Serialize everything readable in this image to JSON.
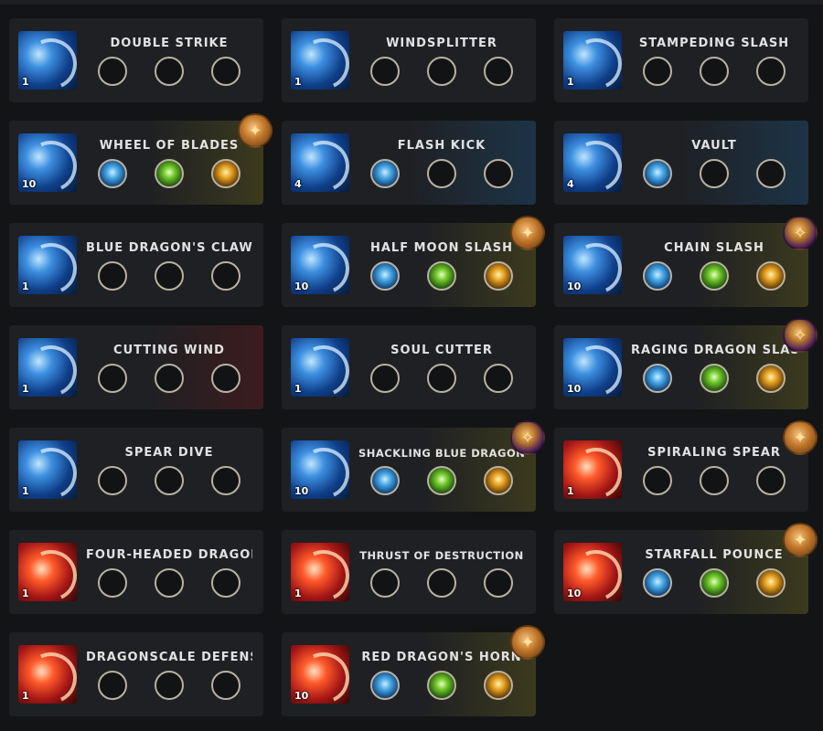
{
  "skills": [
    {
      "name": "DOUBLE STRIKE",
      "level": "1",
      "icon": "blue-swirl-skill-icon",
      "tripods": [
        null,
        null,
        null
      ],
      "rune": null
    },
    {
      "name": "WINDSPLITTER",
      "level": "1",
      "icon": "blue-swirl-skill-icon",
      "tripods": [
        null,
        null,
        null
      ],
      "rune": null
    },
    {
      "name": "STAMPEDING SLASH",
      "level": "1",
      "icon": "blue-swirl-skill-icon",
      "tripods": [
        null,
        null,
        null
      ],
      "rune": null
    },
    {
      "name": "WHEEL OF BLADES",
      "level": "10",
      "icon": "blue-swirl-skill-icon",
      "tripods": [
        "blue",
        "green",
        "orange"
      ],
      "rune": "bronze"
    },
    {
      "name": "FLASH KICK",
      "level": "4",
      "icon": "blue-swirl-skill-icon",
      "tripods": [
        "blue",
        null,
        null
      ],
      "rune": null
    },
    {
      "name": "VAULT",
      "level": "4",
      "icon": "blue-swirl-skill-icon",
      "tripods": [
        "blue",
        null,
        null
      ],
      "rune": null
    },
    {
      "name": "BLUE DRAGON'S CLAW",
      "level": "1",
      "icon": "blue-swirl-skill-icon",
      "tripods": [
        null,
        null,
        null
      ],
      "rune": null
    },
    {
      "name": "HALF MOON SLASH",
      "level": "10",
      "icon": "blue-swirl-skill-icon",
      "tripods": [
        "blue",
        "green",
        "orange"
      ],
      "rune": "bronze"
    },
    {
      "name": "CHAIN SLASH",
      "level": "10",
      "icon": "blue-swirl-skill-icon",
      "tripods": [
        "blue",
        "green",
        "orange"
      ],
      "rune": "purple"
    },
    {
      "name": "CUTTING WIND",
      "level": "1",
      "icon": "blue-swirl-skill-icon",
      "tripods": [
        null,
        null,
        null
      ],
      "rune": null
    },
    {
      "name": "SOUL CUTTER",
      "level": "1",
      "icon": "blue-swirl-skill-icon",
      "tripods": [
        null,
        null,
        null
      ],
      "rune": null
    },
    {
      "name": "RAGING DRAGON SLASH",
      "level": "10",
      "icon": "blue-swirl-skill-icon",
      "tripods": [
        "blue",
        "green",
        "orange"
      ],
      "rune": "purple"
    },
    {
      "name": "SPEAR DIVE",
      "level": "1",
      "icon": "blue-swirl-skill-icon",
      "tripods": [
        null,
        null,
        null
      ],
      "rune": null
    },
    {
      "name": "SHACKLING BLUE DRAGON",
      "level": "10",
      "icon": "blue-swirl-skill-icon",
      "tripods": [
        "blue",
        "green",
        "orange"
      ],
      "rune": "purple"
    },
    {
      "name": "SPIRALING SPEAR",
      "level": "1",
      "icon": "red-flame-skill-icon",
      "tripods": [
        null,
        null,
        null
      ],
      "rune": "bronze"
    },
    {
      "name": "FOUR-HEADED DRAGON",
      "level": "1",
      "icon": "red-flame-skill-icon",
      "tripods": [
        null,
        null,
        null
      ],
      "rune": null
    },
    {
      "name": "THRUST OF DESTRUCTION",
      "level": "1",
      "icon": "red-flame-skill-icon",
      "tripods": [
        null,
        null,
        null
      ],
      "rune": null
    },
    {
      "name": "STARFALL POUNCE",
      "level": "10",
      "icon": "red-flame-skill-icon",
      "tripods": [
        "blue",
        "green",
        "orange"
      ],
      "rune": "bronze"
    },
    {
      "name": "DRAGONSCALE DEFENSE",
      "level": "1",
      "icon": "red-flame-skill-icon",
      "tripods": [
        null,
        null,
        null
      ],
      "rune": null
    },
    {
      "name": "RED DRAGON'S HORN",
      "level": "10",
      "icon": "red-flame-skill-icon",
      "tripods": [
        "blue",
        "green",
        "orange"
      ],
      "rune": "bronze"
    }
  ],
  "colors": {
    "background": "#131416",
    "card": "#1f2023",
    "text": "#e2e2e2",
    "slot_border": "#b9b2a2",
    "tripod_blue": "#49a9e8",
    "tripod_green": "#71c82c",
    "tripod_orange": "#e7a324",
    "rune_bronze": "#c0762a",
    "rune_purple": "#4a1c58"
  }
}
